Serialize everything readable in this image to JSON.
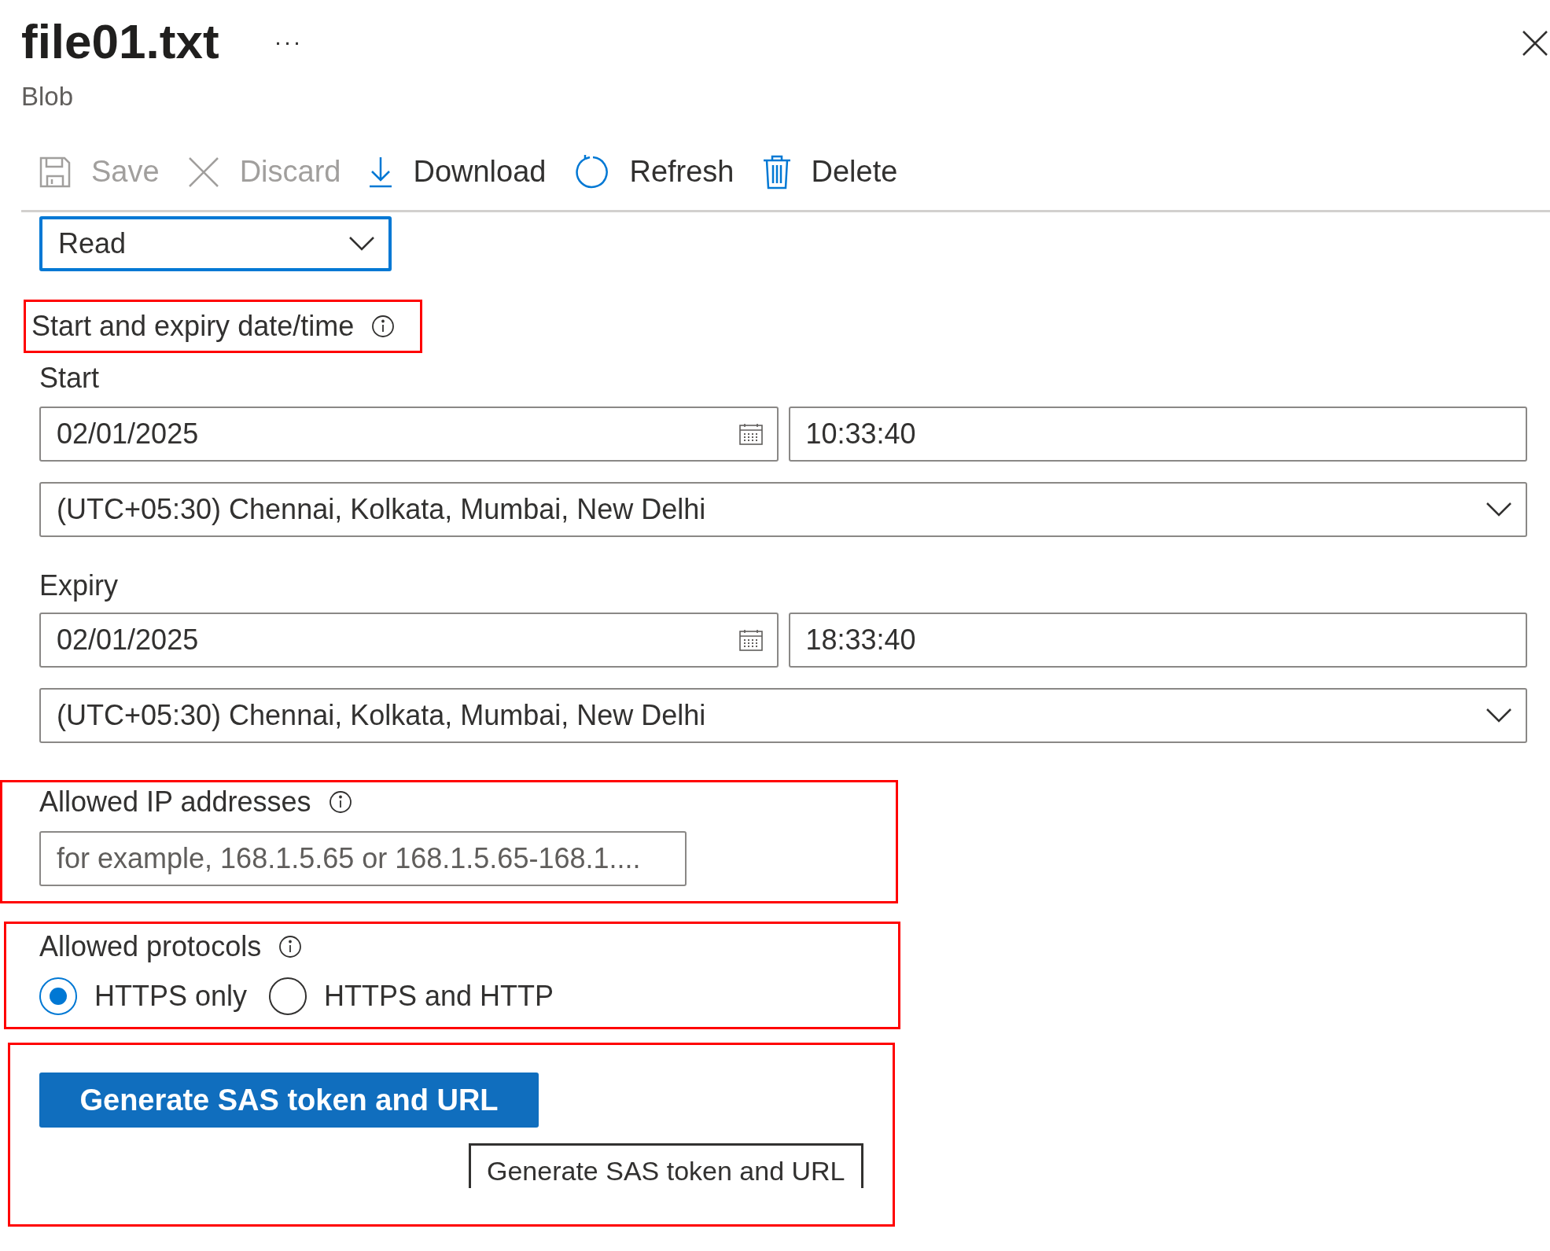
{
  "header": {
    "title": "file01.txt",
    "more": "···",
    "subtitle": "Blob"
  },
  "toolbar": [
    {
      "kind": "save",
      "label": "Save",
      "disabled": true
    },
    {
      "kind": "discard",
      "label": "Discard",
      "disabled": true
    },
    {
      "kind": "download",
      "label": "Download",
      "disabled": false
    },
    {
      "kind": "refresh",
      "label": "Refresh",
      "disabled": false
    },
    {
      "kind": "delete",
      "label": "Delete",
      "disabled": false
    }
  ],
  "permissions": {
    "value": "Read",
    "focused": true
  },
  "date_section": {
    "title": "Start and expiry date/time",
    "highlighted": true
  },
  "times": [
    {
      "label": "Start",
      "date": "02/01/2025",
      "time": "10:33:40",
      "timezone": "(UTC+05:30) Chennai, Kolkata, Mumbai, New Delhi"
    },
    {
      "label": "Expiry",
      "date": "02/01/2025",
      "time": "18:33:40",
      "timezone": "(UTC+05:30) Chennai, Kolkata, Mumbai, New Delhi"
    }
  ],
  "ip": {
    "label": "Allowed IP addresses",
    "placeholder": "for example, 168.1.5.65 or 168.1.5.65-168.1....",
    "highlighted": true
  },
  "protocols": {
    "label": "Allowed protocols",
    "highlighted": true,
    "options": [
      {
        "label": "HTTPS only",
        "selected": true
      },
      {
        "label": "HTTPS and HTTP",
        "selected": false
      }
    ]
  },
  "generate": {
    "button": "Generate SAS token and URL",
    "tooltip": "Generate SAS token and URL",
    "highlighted": true
  }
}
